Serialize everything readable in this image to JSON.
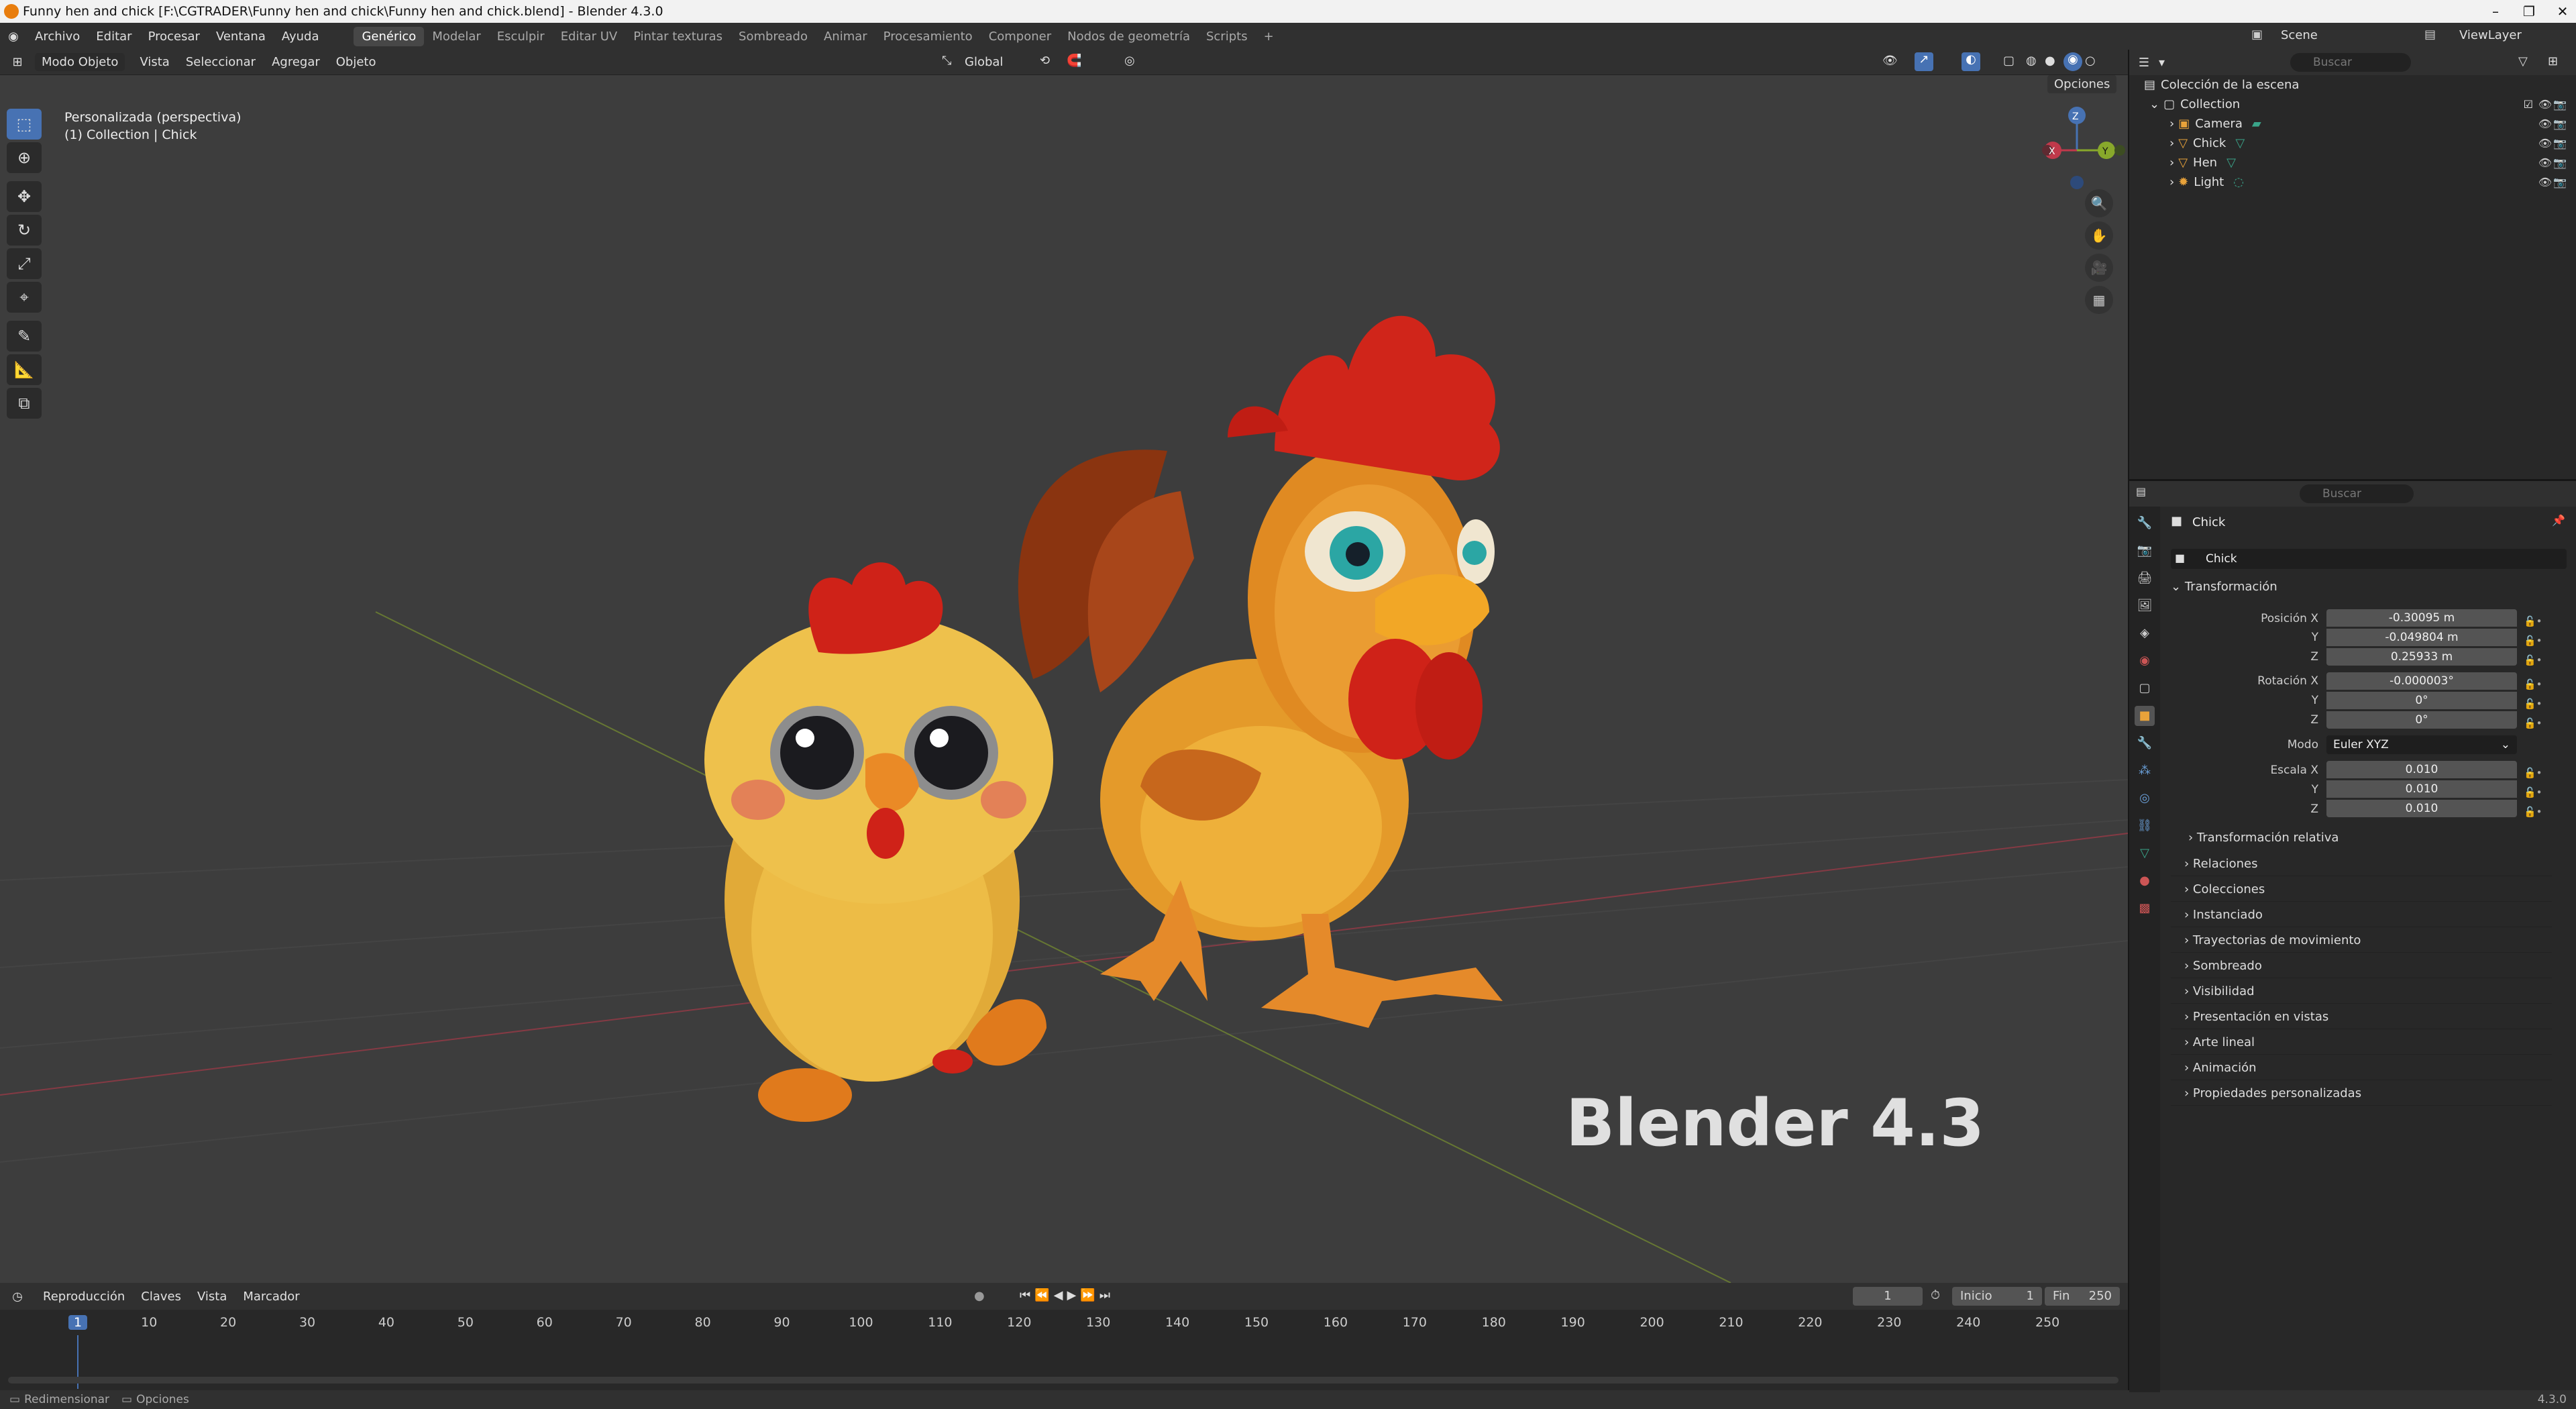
{
  "window": {
    "title": "Funny hen and chick [F:\\CGTRADER\\Funny hen and chick\\Funny hen and chick.blend] - Blender 4.3.0",
    "controls": [
      "–",
      "❐",
      "✕"
    ]
  },
  "menu": [
    "Archivo",
    "Editar",
    "Procesar",
    "Ventana",
    "Ayuda"
  ],
  "workspaces": [
    "Genérico",
    "Modelar",
    "Esculpir",
    "Editar UV",
    "Pintar texturas",
    "Sombreado",
    "Animar",
    "Procesamiento",
    "Componer",
    "Nodos de geometría",
    "Scripts"
  ],
  "workspace_add": "+",
  "scene": {
    "label": "Scene",
    "view_layer": "ViewLayer"
  },
  "viewport_header": {
    "mode": "Modo Objeto",
    "menus": [
      "Vista",
      "Seleccionar",
      "Agregar",
      "Objeto"
    ],
    "orientation": "Global",
    "options": "Opciones"
  },
  "viewport": {
    "view_name": "Personalizada (perspectiva)",
    "collection_info": "(1) Collection | Chick",
    "watermark": "Blender 4.3",
    "gizmo": {
      "x": "X",
      "y": "Y",
      "z": "Z"
    }
  },
  "outliner": {
    "search_placeholder": "Buscar",
    "root": "Colección de la escena",
    "collection": "Collection",
    "items": [
      {
        "name": "Camera",
        "icon": "camera-icon"
      },
      {
        "name": "Chick",
        "icon": "mesh-icon"
      },
      {
        "name": "Hen",
        "icon": "mesh-icon"
      },
      {
        "name": "Light",
        "icon": "light-icon"
      }
    ]
  },
  "properties": {
    "search_placeholder": "Buscar",
    "object_name": "Chick",
    "data_name": "Chick",
    "transform_title": "Transformación",
    "location": {
      "label": "Posición X",
      "x": "-0.30095 m",
      "y_label": "Y",
      "y": "-0.049804 m",
      "z_label": "Z",
      "z": "0.25933 m"
    },
    "rotation": {
      "label": "Rotación X",
      "x": "-0.000003°",
      "y_label": "Y",
      "y": "0°",
      "z_label": "Z",
      "z": "0°"
    },
    "mode": {
      "label": "Modo",
      "value": "Euler XYZ"
    },
    "scale": {
      "label": "Escala X",
      "x": "0.010",
      "y_label": "Y",
      "y": "0.010",
      "z_label": "Z",
      "z": "0.010"
    },
    "delta": "Transformación relativa",
    "panels": [
      "Relaciones",
      "Colecciones",
      "Instanciado",
      "Trayectorias de movimiento",
      "Sombreado",
      "Visibilidad",
      "Presentación en vistas",
      "Arte lineal",
      "Animación",
      "Propiedades personalizadas"
    ]
  },
  "timeline": {
    "menus": [
      "Reproducción",
      "Claves",
      "Vista",
      "Marcador"
    ],
    "current_frame": "1",
    "start_label": "Inicio",
    "start": "1",
    "end_label": "Fin",
    "end": "250",
    "ticks": [
      "1",
      "10",
      "20",
      "30",
      "40",
      "50",
      "60",
      "70",
      "80",
      "90",
      "100",
      "110",
      "120",
      "130",
      "140",
      "150",
      "160",
      "170",
      "180",
      "190",
      "200",
      "210",
      "220",
      "230",
      "240",
      "250"
    ]
  },
  "statusbar": {
    "left1": "Redimensionar",
    "left2": "Opciones",
    "version": "4.3.0"
  },
  "colors": {
    "accent": "#4772b3",
    "selection": "#e87d0d",
    "axis_x": "#c0394b",
    "axis_y": "#88a82b"
  }
}
